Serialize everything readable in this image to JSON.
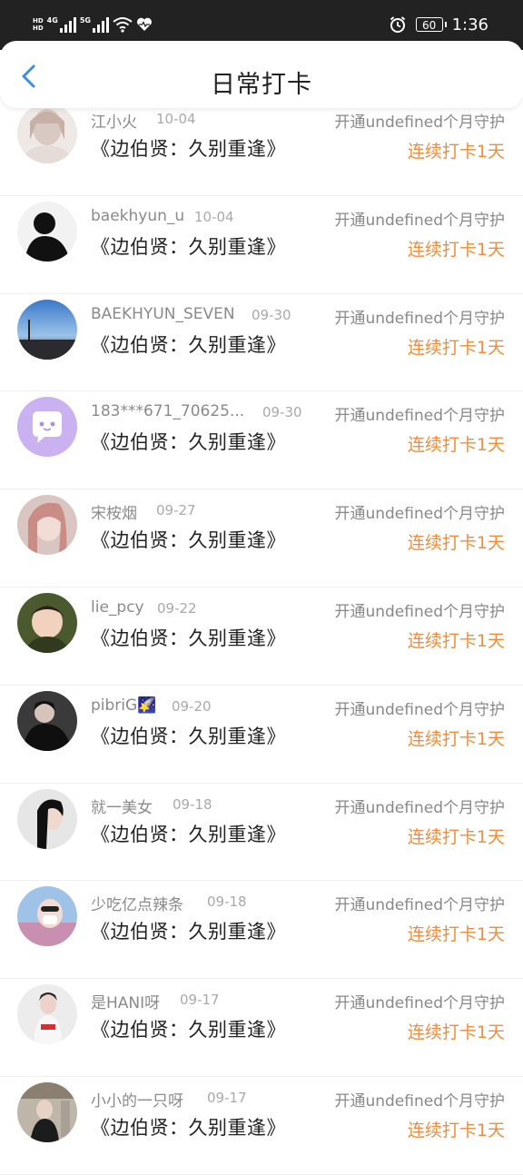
{
  "status_bar": {
    "hd1": "HD",
    "hd2": "HD",
    "net1": "4G",
    "net2": "5G",
    "battery": "60",
    "time": "1:36"
  },
  "header": {
    "title": "日常打卡"
  },
  "colors": {
    "accent": "#3a8ee6",
    "streak": "#f28c38",
    "muted": "#8a8a8a"
  },
  "rows": [
    {
      "name": "江小火",
      "date": "10-04",
      "guard": "开通undefined个月守护",
      "book": "《边伯贤：久别重逢》",
      "streak": "连续打卡1天"
    },
    {
      "name": "baekhyun_u",
      "date": "10-04",
      "guard": "开通undefined个月守护",
      "book": "《边伯贤：久别重逢》",
      "streak": "连续打卡1天"
    },
    {
      "name": "BAEKHYUN_SEVEN",
      "date": "09-30",
      "guard": "开通undefined个月守护",
      "book": "《边伯贤：久别重逢》",
      "streak": "连续打卡1天"
    },
    {
      "name": "183***671_70625...",
      "date": "09-30",
      "guard": "开通undefined个月守护",
      "book": "《边伯贤：久别重逢》",
      "streak": "连续打卡1天"
    },
    {
      "name": "宋桉烟",
      "date": "09-27",
      "guard": "开通undefined个月守护",
      "book": "《边伯贤：久别重逢》",
      "streak": "连续打卡1天"
    },
    {
      "name": "lie_pcy",
      "date": "09-22",
      "guard": "开通undefined个月守护",
      "book": "《边伯贤：久别重逢》",
      "streak": "连续打卡1天"
    },
    {
      "name": "pibriG🌠",
      "date": "09-20",
      "guard": "开通undefined个月守护",
      "book": "《边伯贤：久别重逢》",
      "streak": "连续打卡1天"
    },
    {
      "name": "就一美女",
      "date": "09-18",
      "guard": "开通undefined个月守护",
      "book": "《边伯贤：久别重逢》",
      "streak": "连续打卡1天"
    },
    {
      "name": "少吃亿点辣条",
      "date": "09-18",
      "guard": "开通undefined个月守护",
      "book": "《边伯贤：久别重逢》",
      "streak": "连续打卡1天"
    },
    {
      "name": "是HANI呀",
      "date": "09-17",
      "guard": "开通undefined个月守护",
      "book": "《边伯贤：久别重逢》",
      "streak": "连续打卡1天"
    },
    {
      "name": "小小的一只呀",
      "date": "09-17",
      "guard": "开通undefined个月守护",
      "book": "《边伯贤：久别重逢》",
      "streak": "连续打卡1天"
    }
  ]
}
